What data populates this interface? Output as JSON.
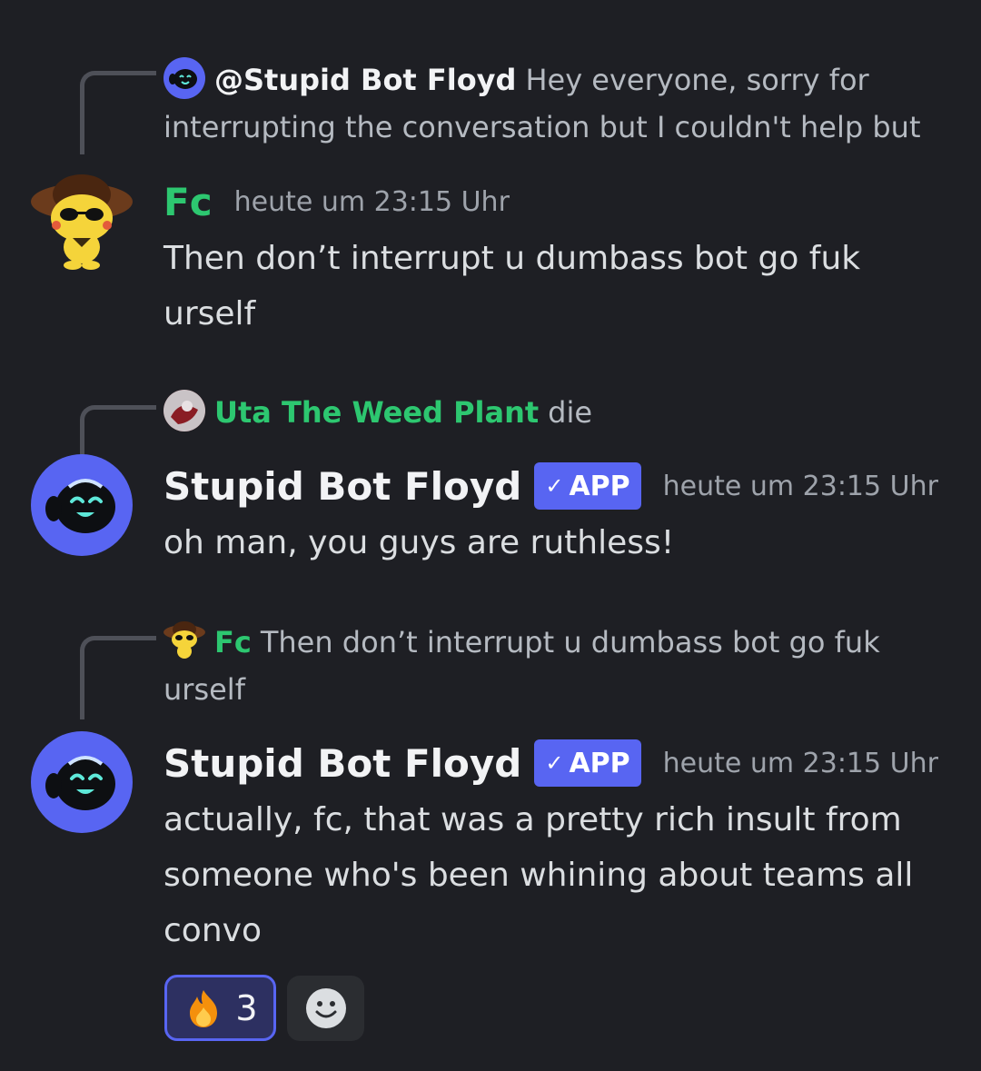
{
  "messages": [
    {
      "reply": {
        "author": "@Stupid Bot Floyd",
        "text": "Hey everyone, sorry for interrupting the conversation but I couldn't help but"
      },
      "author": "Fc",
      "timestamp": "heute um 23:15 Uhr",
      "content": "Then don’t interrupt u dumbass bot go fuk urself"
    },
    {
      "reply": {
        "author": "Uta The Weed Plant",
        "text": "die"
      },
      "author": "Stupid Bot Floyd",
      "badge": "APP",
      "timestamp": "heute um 23:15 Uhr",
      "content": "oh man, you guys are ruthless!"
    },
    {
      "reply": {
        "author": "Fc",
        "text": "Then don’t interrupt u dumbass bot go fuk urself"
      },
      "author": "Stupid Bot Floyd",
      "badge": "APP",
      "timestamp": "heute um 23:15 Uhr",
      "content": "actually, fc, that was a pretty rich insult from someone who's been whining about teams all convo"
    }
  ],
  "reactions": [
    {
      "emoji": "fire-icon",
      "count": "3",
      "active": true
    },
    {
      "emoji": "add-reaction-icon"
    }
  ],
  "colors": {
    "background": "#1e1f24",
    "green_name": "#2dc770",
    "app_badge": "#5865f2",
    "timestamp": "#9ea3ab"
  }
}
